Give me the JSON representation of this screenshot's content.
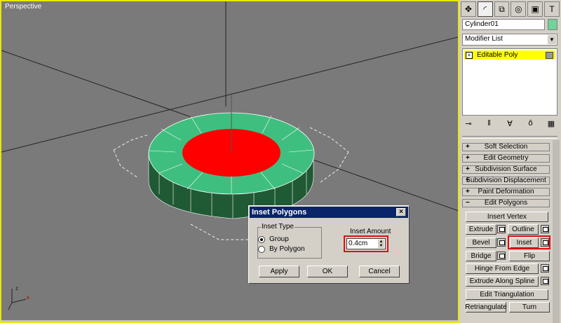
{
  "viewport": {
    "label": "Perspective"
  },
  "toolbar": {
    "tabs": [
      "create-tab",
      "modify-tab",
      "hierarchy-tab",
      "motion-tab",
      "display-tab",
      "utilities-tab"
    ]
  },
  "panel": {
    "object_name": "Cylinder01",
    "object_color": "#6fd39a",
    "modifier_list": "Modifier List",
    "stack_item": "Editable Poly",
    "rollouts": {
      "soft_selection": "Soft Selection",
      "edit_geometry": "Edit Geometry",
      "subdivision_surface": "Subdivision Surface",
      "subdivision_displacement": "Subdivision Displacement",
      "paint_deformation": "Paint Deformation",
      "edit_polygons": "Edit Polygons"
    },
    "buttons": {
      "insert_vertex": "Insert Vertex",
      "extrude": "Extrude",
      "outline": "Outline",
      "bevel": "Bevel",
      "inset": "Inset",
      "bridge": "Bridge",
      "flip": "Flip",
      "hinge_from_edge": "Hinge From Edge",
      "extrude_along_spline": "Extrude Along Spline",
      "edit_triangulation": "Edit Triangulation",
      "retriangulate": "Retriangulate",
      "turn": "Turn"
    }
  },
  "dialog": {
    "title": "Inset Polygons",
    "close": "×",
    "inset_type_label": "Inset Type",
    "option_group": "Group",
    "option_by_polygon": "By Polygon",
    "selected_option": "Group",
    "amount_label": "Inset Amount",
    "amount_value": "0.4cm",
    "apply": "Apply",
    "ok": "OK",
    "cancel": "Cancel"
  },
  "colors": {
    "accent_red": "#e01010",
    "selection_yellow": "#ffff00",
    "face_red": "#ff0000",
    "face_green": "#3fbf7f"
  }
}
